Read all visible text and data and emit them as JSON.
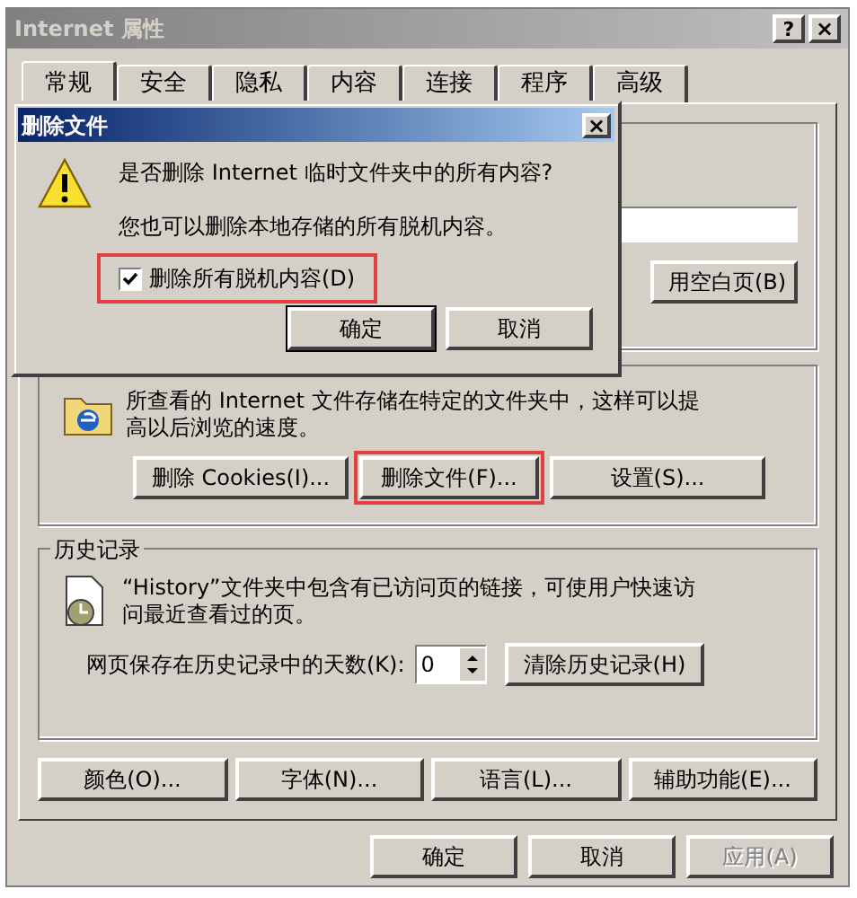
{
  "window": {
    "title": "Internet 属性",
    "help": "?",
    "close": "×"
  },
  "tabs": [
    {
      "label": "常规",
      "selected": true
    },
    {
      "label": "安全",
      "selected": false
    },
    {
      "label": "隐私",
      "selected": false
    },
    {
      "label": "内容",
      "selected": false
    },
    {
      "label": "连接",
      "selected": false
    },
    {
      "label": "程序",
      "selected": false
    },
    {
      "label": "高级",
      "selected": false
    }
  ],
  "home_page": {
    "button": "用空白页(B)"
  },
  "temp_files": {
    "text": "所查看的 Internet 文件存储在特定的文件夹中，这样可以提高以后浏览的速度。",
    "buttons": [
      {
        "label": "删除 Cookies(I)...",
        "highlighted": false
      },
      {
        "label": "删除文件(F)...",
        "highlighted": true
      },
      {
        "label": "设置(S)...",
        "highlighted": false
      }
    ]
  },
  "history": {
    "title": "历史记录",
    "text": "“History”文件夹中包含有已访问页的链接，可使用户快速访问最近查看过的页。",
    "days_label": "网页保存在历史记录中的天数(K):",
    "days_value": "0",
    "clear_button": "清除历史记录(H)"
  },
  "bottom_buttons": [
    "颜色(O)...",
    "字体(N)...",
    "语言(L)...",
    "辅助功能(E)..."
  ],
  "actions": [
    {
      "label": "确定",
      "disabled": false
    },
    {
      "label": "取消",
      "disabled": false
    },
    {
      "label": "应用(A)",
      "disabled": true
    }
  ],
  "dialog": {
    "title": "删除文件",
    "close": "×",
    "question": "是否删除 Internet 临时文件夹中的所有内容?",
    "note": "您也可以删除本地存储的所有脱机内容。",
    "checkbox": {
      "label": "删除所有脱机内容(D)",
      "checked": true,
      "highlighted": true
    },
    "buttons": [
      {
        "label": "确定",
        "default": true
      },
      {
        "label": "取消",
        "default": false
      }
    ]
  }
}
